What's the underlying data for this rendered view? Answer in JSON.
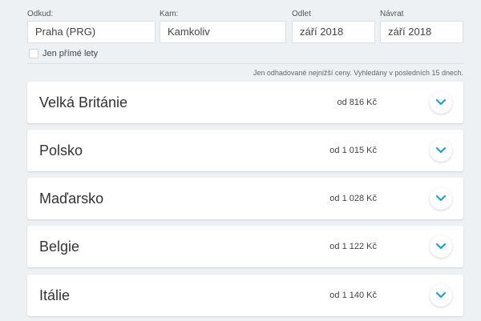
{
  "form": {
    "from": {
      "label": "Odkud:",
      "value": "Praha (PRG)"
    },
    "to": {
      "label": "Kam:",
      "value": "Kamkoliv"
    },
    "depart": {
      "label": "Odlet",
      "value": "září 2018"
    },
    "return": {
      "label": "Návrat",
      "value": "září 2018"
    },
    "direct_label": "Jen přímé lety",
    "direct_checked": false
  },
  "note": "Jen odhadované nejnižší ceny. Vyhledány v posledních 15 dnech.",
  "results": [
    {
      "country": "Velká Británie",
      "price": "od 816 Kč"
    },
    {
      "country": "Polsko",
      "price": "od 1 015 Kč"
    },
    {
      "country": "Maďarsko",
      "price": "od 1 028 Kč"
    },
    {
      "country": "Belgie",
      "price": "od 1 122 Kč"
    },
    {
      "country": "Itálie",
      "price": "od 1 140 Kč"
    }
  ],
  "icons": {
    "expand": "chevron-down-icon"
  },
  "colors": {
    "accent": "#1aa3d4",
    "background": "#eef1f4"
  }
}
